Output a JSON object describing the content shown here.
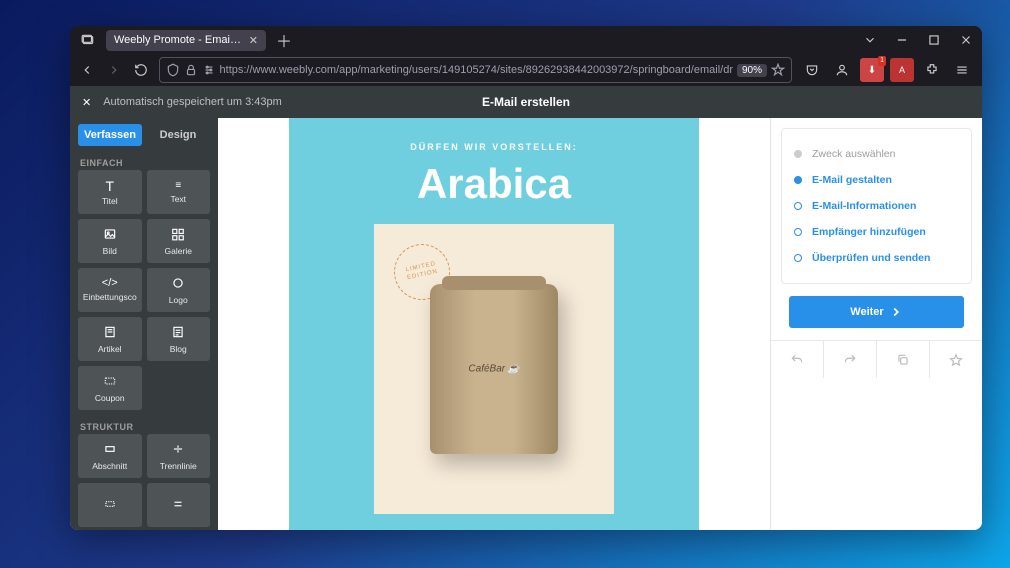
{
  "browser": {
    "tab_title": "Weebly Promote - Email Creation M",
    "url": "https://www.weebly.com/app/marketing/users/149105274/sites/89262938442003972/springboard/email/dr",
    "zoom": "90%"
  },
  "app": {
    "autosave": "Automatisch gespeichert um 3:43pm",
    "title": "E-Mail erstellen"
  },
  "modes": {
    "compose": "Verfassen",
    "design": "Design"
  },
  "sections": {
    "simple": "EINFACH",
    "structure": "STRUKTUR"
  },
  "widgets": {
    "title": "Titel",
    "text": "Text",
    "image": "Bild",
    "gallery": "Galerie",
    "embed": "Einbettungsco",
    "logo": "Logo",
    "article": "Artikel",
    "blog": "Blog",
    "coupon": "Coupon",
    "section": "Abschnitt",
    "divider": "Trennlinie"
  },
  "email": {
    "eyebrow": "DÜRFEN WIR VORSTELLEN:",
    "headline": "Arabica",
    "stamp": "LIMITED EDITION",
    "product": "CaféBar"
  },
  "steps": {
    "s1": "Zweck auswählen",
    "s2": "E-Mail gestalten",
    "s3": "E-Mail-Informationen",
    "s4": "Empfänger hinzufügen",
    "s5": "Überprüfen und senden"
  },
  "cta": "Weiter"
}
